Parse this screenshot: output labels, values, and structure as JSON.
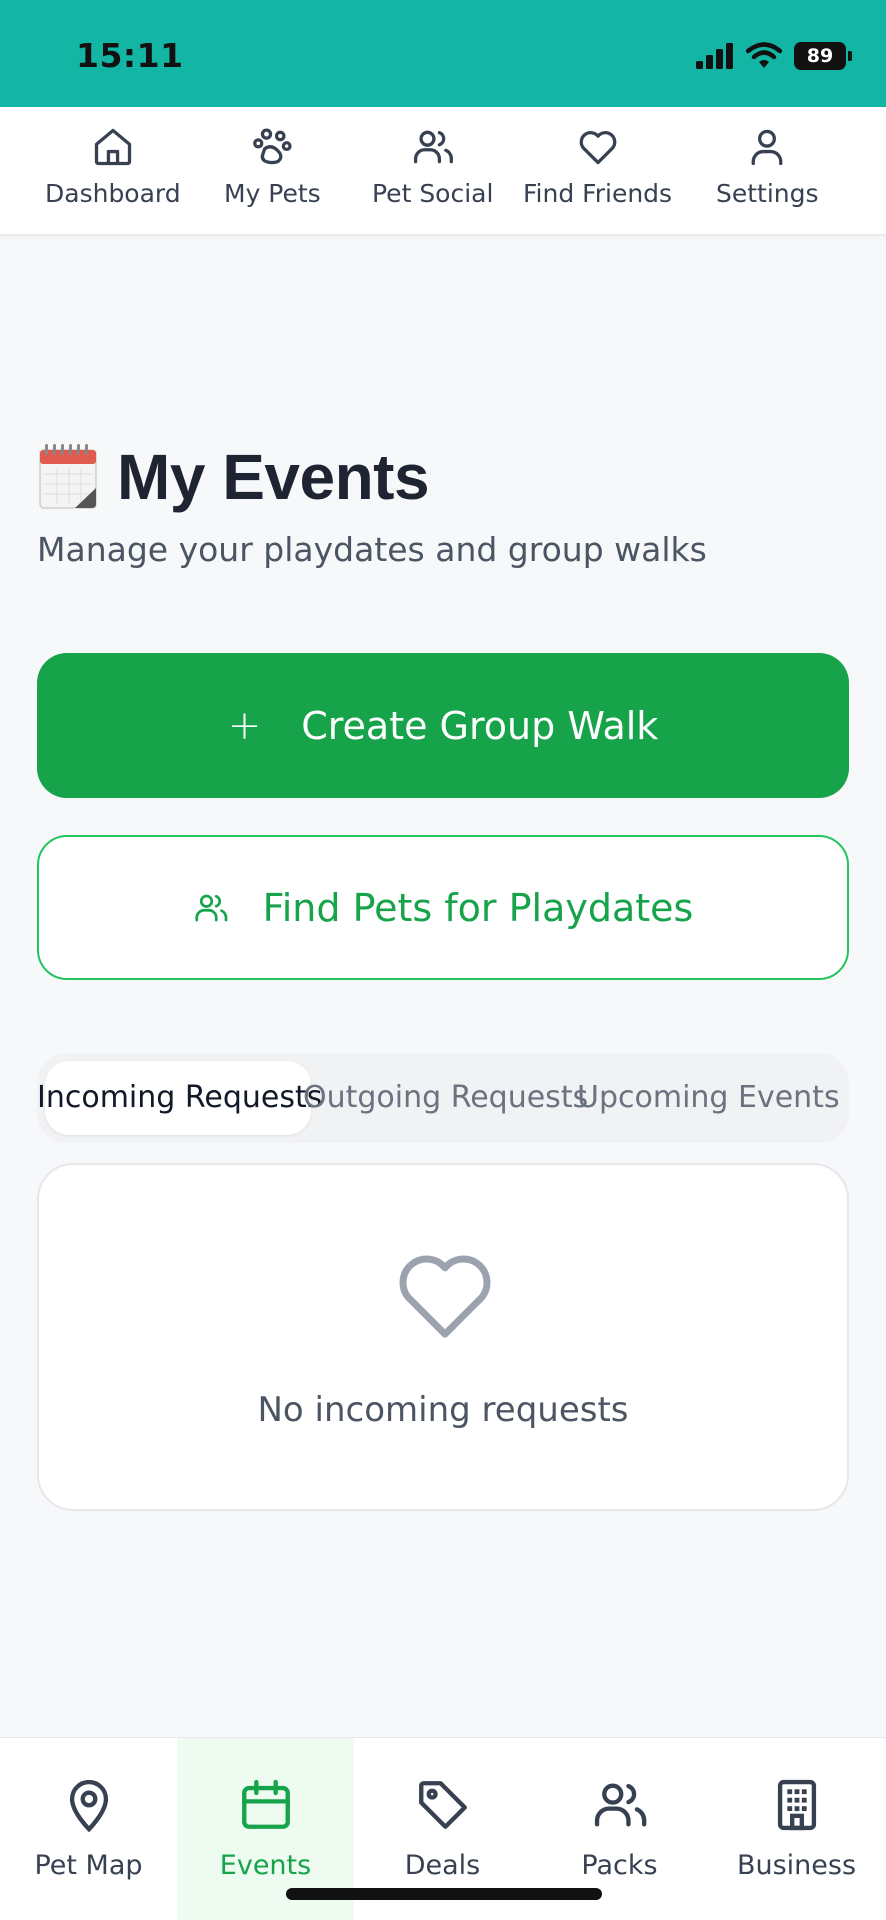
{
  "status_bar": {
    "time": "15:11",
    "battery": "89"
  },
  "top_nav": {
    "items": [
      {
        "label": "Dashboard",
        "icon": "home-icon"
      },
      {
        "label": "My Pets",
        "icon": "paw-icon"
      },
      {
        "label": "Pet Social",
        "icon": "users-icon"
      },
      {
        "label": "Find Friends",
        "icon": "heart-icon"
      },
      {
        "label": "Settings",
        "icon": "user-icon"
      }
    ]
  },
  "header": {
    "emoji": "calendar-emoji",
    "title": "My Events",
    "subtitle": "Manage your playdates and group walks"
  },
  "actions": {
    "create_walk_label": "Create Group Walk",
    "create_walk_icon": "plus-icon",
    "find_pets_label": "Find Pets for Playdates",
    "find_pets_icon": "users-icon"
  },
  "tabs": {
    "items": [
      {
        "label": "Incoming Requests",
        "active": true
      },
      {
        "label": "Outgoing Requests",
        "active": false
      },
      {
        "label": "Upcoming Events",
        "active": false
      }
    ]
  },
  "empty_state": {
    "icon": "heart-icon",
    "text": "No incoming requests"
  },
  "bottom_nav": {
    "items": [
      {
        "label": "Pet Map",
        "icon": "map-pin-icon",
        "active": false
      },
      {
        "label": "Events",
        "icon": "calendar-icon",
        "active": true
      },
      {
        "label": "Deals",
        "icon": "tag-icon",
        "active": false
      },
      {
        "label": "Packs",
        "icon": "users-icon",
        "active": false
      },
      {
        "label": "Business",
        "icon": "building-icon",
        "active": false
      }
    ]
  },
  "colors": {
    "status_bar": "#13b6a5",
    "primary": "#16a34a",
    "primary_border": "#22c55e",
    "active_tab_bg": "#edfbf1"
  }
}
